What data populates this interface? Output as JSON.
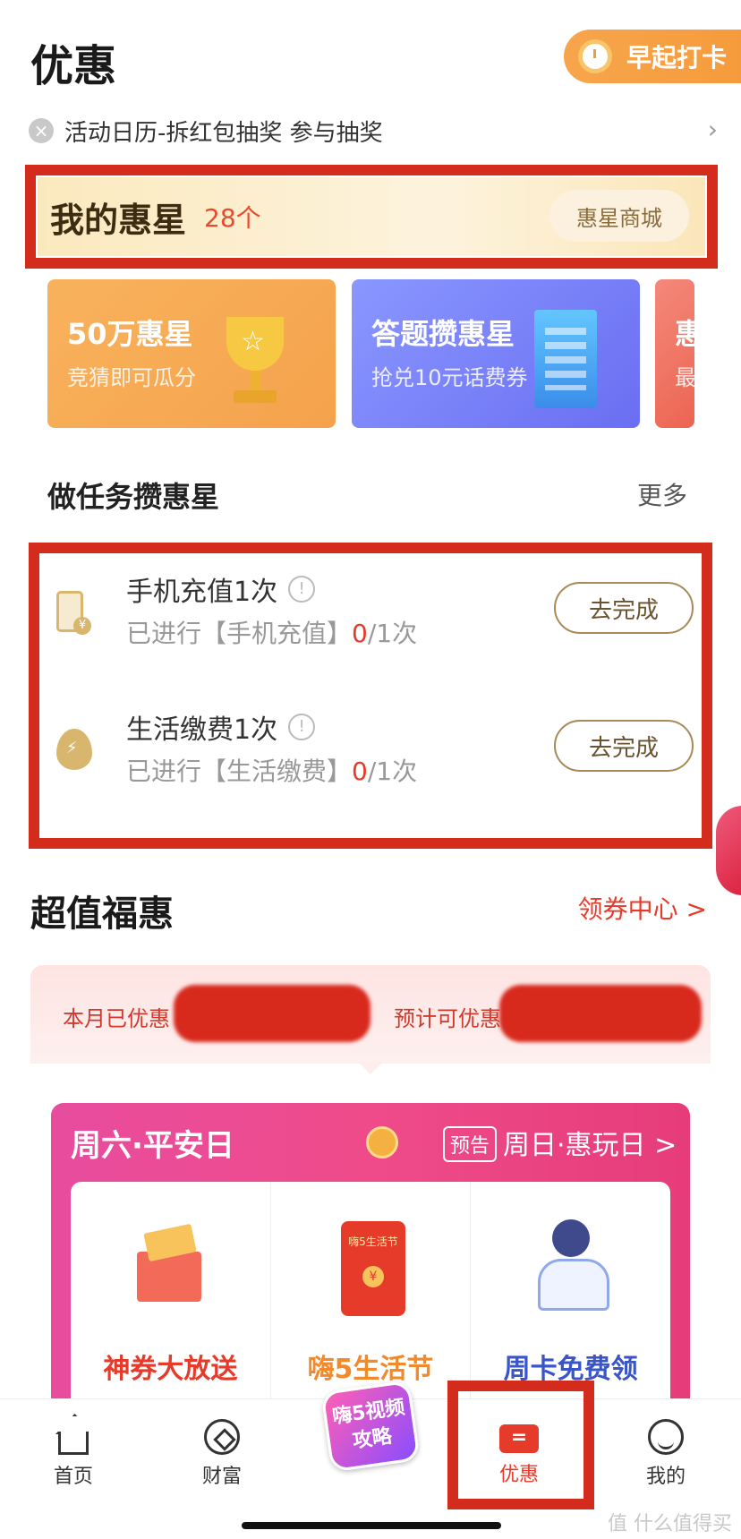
{
  "header": {
    "title": "优惠",
    "early_checkin": "早起打卡"
  },
  "notice": {
    "text": "活动日历-拆红包抽奖 参与抽奖"
  },
  "stars": {
    "title": "我的惠星",
    "count": "28个",
    "mall": "惠星商城"
  },
  "banners": [
    {
      "title": "50万惠星",
      "subtitle": "竞猜即可瓜分"
    },
    {
      "title": "答题攒惠星",
      "subtitle": "抢兑10元话费券"
    },
    {
      "title": "惠",
      "subtitle": "最"
    }
  ],
  "tasks_section": {
    "title": "做任务攒惠星",
    "more": "更多"
  },
  "tasks": [
    {
      "title": "手机充值1次",
      "progress_prefix": "已进行【手机充值】",
      "done": "0",
      "total": "/1次",
      "action": "去完成",
      "icon": "phone-charge-icon"
    },
    {
      "title": "生活缴费1次",
      "progress_prefix": "已进行【生活缴费】",
      "done": "0",
      "total": "/1次",
      "action": "去完成",
      "icon": "utility-drop-icon"
    }
  ],
  "deals_section": {
    "title": "超值福惠",
    "link": "领券中心 >"
  },
  "summary": {
    "saved_label": "本月已优惠",
    "expected_label": "预计可优惠"
  },
  "weekday_panel": {
    "title": "周六·平安日",
    "preview_tag": "预告",
    "next": "周日·惠玩日 >",
    "promos": [
      {
        "label": "神券大放送",
        "color": "#e63a2a"
      },
      {
        "label": "嗨5生活节",
        "color": "#f08a2a"
      },
      {
        "label": "周卡免费领",
        "color": "#3a55c8"
      }
    ]
  },
  "tabbar": {
    "items": [
      {
        "label": "首页"
      },
      {
        "label": "财富"
      },
      {
        "label": "优惠"
      },
      {
        "label": "我的"
      }
    ],
    "center_badge": "嗨5视频攻略"
  },
  "watermark": "值 什么值得买",
  "colors": {
    "accent_red": "#e63a2a",
    "gold": "#a88a58",
    "highlight_box": "#d42c1c"
  }
}
